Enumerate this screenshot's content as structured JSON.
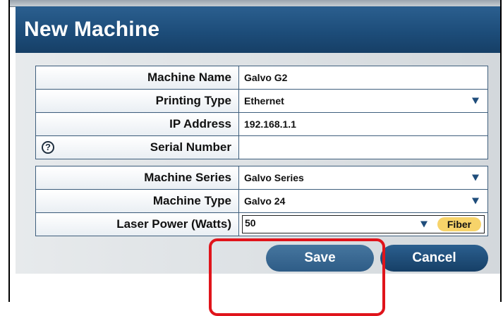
{
  "dialog": {
    "title": "New Machine"
  },
  "connection_section": {
    "rows": [
      {
        "label": "Machine Name",
        "value": "Galvo G2"
      },
      {
        "label": "Printing Type",
        "value": "Ethernet"
      },
      {
        "label": "IP Address",
        "value": "192.168.1.1"
      },
      {
        "label": "Serial Number",
        "value": ""
      }
    ]
  },
  "machine_section": {
    "rows": [
      {
        "label": "Machine Series",
        "value": "Galvo Series"
      },
      {
        "label": "Machine Type",
        "value": "Galvo 24"
      },
      {
        "label": "Laser Power (Watts)",
        "value": "50",
        "badge": "Fiber"
      }
    ]
  },
  "buttons": {
    "save_label": "Save",
    "cancel_label": "Cancel"
  },
  "icons": {
    "help": "?"
  },
  "colors": {
    "header": "#1d4d7a",
    "badge": "#f7d36a",
    "highlight": "#e0141b"
  }
}
